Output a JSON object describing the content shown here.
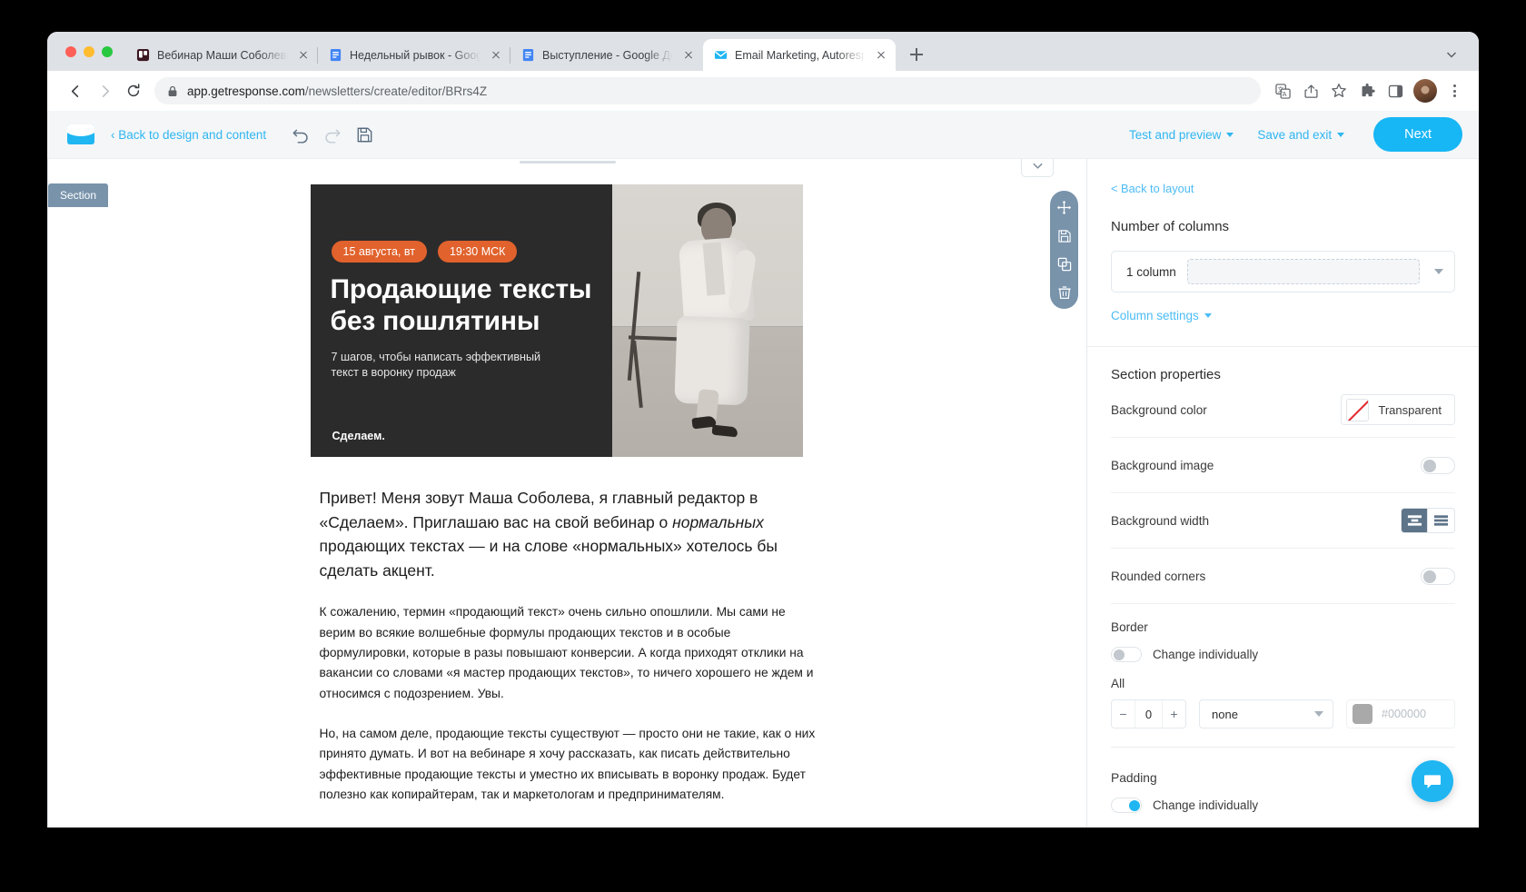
{
  "browser": {
    "tabs": [
      {
        "title": "Вебинар Маши Соболевой о",
        "favicon": "trello-icon",
        "active": false
      },
      {
        "title": "Недельный рывок - Google Д",
        "favicon": "google-docs-icon",
        "active": false
      },
      {
        "title": "Выступление - Google Докум",
        "favicon": "google-docs-icon",
        "active": false
      },
      {
        "title": "Email Marketing, Autoresponde",
        "favicon": "getresponse-mail-icon",
        "active": true
      }
    ],
    "new_tab_label": "+",
    "omnibox": {
      "lock_icon": "lock-icon",
      "url_domain": "app.getresponse.com",
      "url_path": "/newsletters/create/editor/BRrs4Z"
    },
    "toolbar_icons": [
      "translate-icon",
      "share-icon",
      "bookmark-star-icon",
      "extensions-puzzle-icon",
      "side-panel-icon",
      "profile-avatar",
      "chrome-menu-kebab-icon"
    ],
    "nav": {
      "back": "back-arrow-icon",
      "forward": "forward-arrow-icon",
      "reload": "reload-icon"
    }
  },
  "appbar": {
    "logo": "getresponse-envelope-logo",
    "back_link": "‹ Back to design and content",
    "undo_icon": "undo-icon",
    "redo_icon": "redo-icon",
    "save_icon": "save-floppy-icon",
    "test_and_preview": "Test and preview",
    "save_and_exit": "Save and exit",
    "next_label": "Next"
  },
  "editor": {
    "section_badge": "Section",
    "collapse_icon": "chevron-down-icon",
    "float_tools": [
      "move-icon",
      "save-floppy-icon",
      "duplicate-icon",
      "delete-trash-icon"
    ],
    "banner": {
      "pills": [
        "15 августа, вт",
        "19:30 МСК"
      ],
      "heading": "Продающие тексты без пошлятины",
      "subheading": "7 шагов, чтобы написать эффективный текст в воронку продаж",
      "watermark": "Сделаем.",
      "bg_color": "#2b2b2b",
      "pill_color": "#e1622c",
      "photo_alt": "woman-sitting-on-chair-photo"
    },
    "paragraphs": [
      "Привет! Меня зовут Маша Соболева, я главный редактор в «Сделаем». Приглашаю вас на свой вебинар о нормальных продающих текстах — и на слове «нормальных» хотелось бы сделать акцент.",
      "К сожалению, термин «продающий текст» очень сильно опошлили. Мы сами не верим во всякие волшебные формулы продающих текстов и в особые формулировки, которые в разы повышают конверсии. А когда приходят отклики на вакансии со словами «я мастер продающих текстов», то ничего хорошего не ждем и относимся с подозрением. Увы.",
      "Но, на самом деле, продающие тексты существуют — просто они не такие, как о них принято думать. И вот на вебинаре я хочу рассказать, как писать действительно эффективные продающие тексты и уместно их вписывать в воронку продаж. Будет полезно как копирайтерам, так и маркетологам и предпринимателям."
    ],
    "lead_italic_word": "нормальных"
  },
  "panel": {
    "back_to_layout": "< Back to layout",
    "columns_heading": "Number of columns",
    "columns_value": "1 column",
    "column_settings": "Column settings",
    "section_properties": "Section properties",
    "rows": {
      "background_color": {
        "label": "Background color",
        "value": "Transparent",
        "swatch": "none-diagonal-red"
      },
      "background_image": {
        "label": "Background image",
        "toggle": "off"
      },
      "background_width": {
        "label": "Background width",
        "options": [
          "boxed-width-icon",
          "full-width-icon"
        ],
        "selected": 0
      },
      "rounded_corners": {
        "label": "Rounded corners",
        "toggle": "off"
      }
    },
    "border": {
      "title": "Border",
      "change_individually": "Change individually",
      "change_individually_state": "off",
      "all_label": "All",
      "width_value": "0",
      "minus": "−",
      "plus": "+",
      "style_value": "none",
      "color_hex_placeholder": "#000000",
      "color_swatch": "#a9a9a9"
    },
    "padding": {
      "title": "Padding",
      "change_individually": "Change individually",
      "change_individually_state": "on"
    },
    "accent_color": "#1fb6f2",
    "chat_icon": "chat-bubble-icon"
  }
}
